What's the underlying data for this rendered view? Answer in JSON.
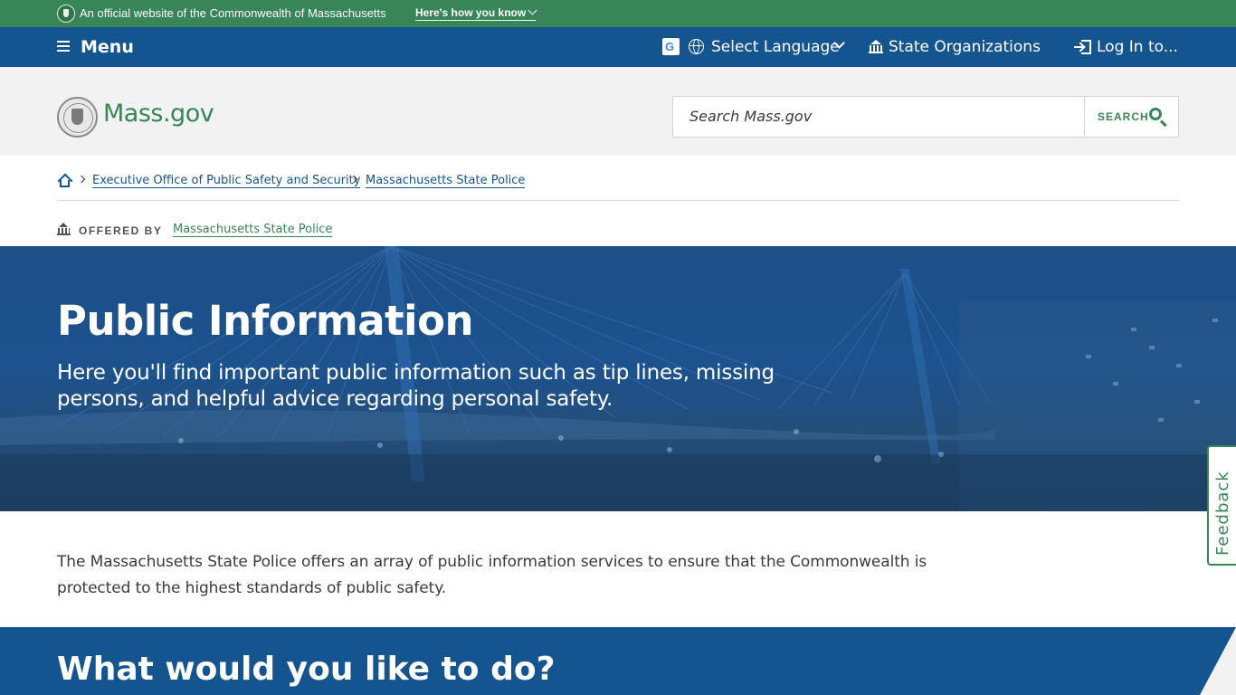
{
  "official_banner": {
    "text": "An official website of the Commonwealth of Massachusetts",
    "link_label": "Here's how you know"
  },
  "utility_nav": {
    "menu_label": "Menu",
    "language_label": "Select Language",
    "organizations_label": "State Organizations",
    "login_label": "Log In to..."
  },
  "header": {
    "logo_text": "Mass.gov",
    "search_placeholder": "Search Mass.gov",
    "search_button_label": "SEARCH"
  },
  "breadcrumb": {
    "items": [
      "Executive Office of Public Safety and Security",
      "Massachusetts State Police"
    ]
  },
  "offered_by": {
    "label": "OFFERED BY",
    "org": "Massachusetts State Police"
  },
  "hero": {
    "title": "Public Information",
    "subtitle": "Here you'll find important public information such as tip lines, missing persons, and helpful advice regarding personal safety."
  },
  "feedback_label": "Feedback",
  "intro_text": "The Massachusetts State Police offers an array of public information services to ensure that the Commonwealth is protected to the highest standards of public safety.",
  "todo_section": {
    "title": "What would you like to do?"
  },
  "colors": {
    "brand_green": "#388557",
    "brand_blue": "#14558f",
    "header_gray": "#f2f2f2"
  },
  "icons": [
    "seal-icon",
    "hamburger-icon",
    "google-icon",
    "globe-icon",
    "chevron-down-icon",
    "building-icon",
    "login-icon",
    "search-icon",
    "home-icon"
  ]
}
